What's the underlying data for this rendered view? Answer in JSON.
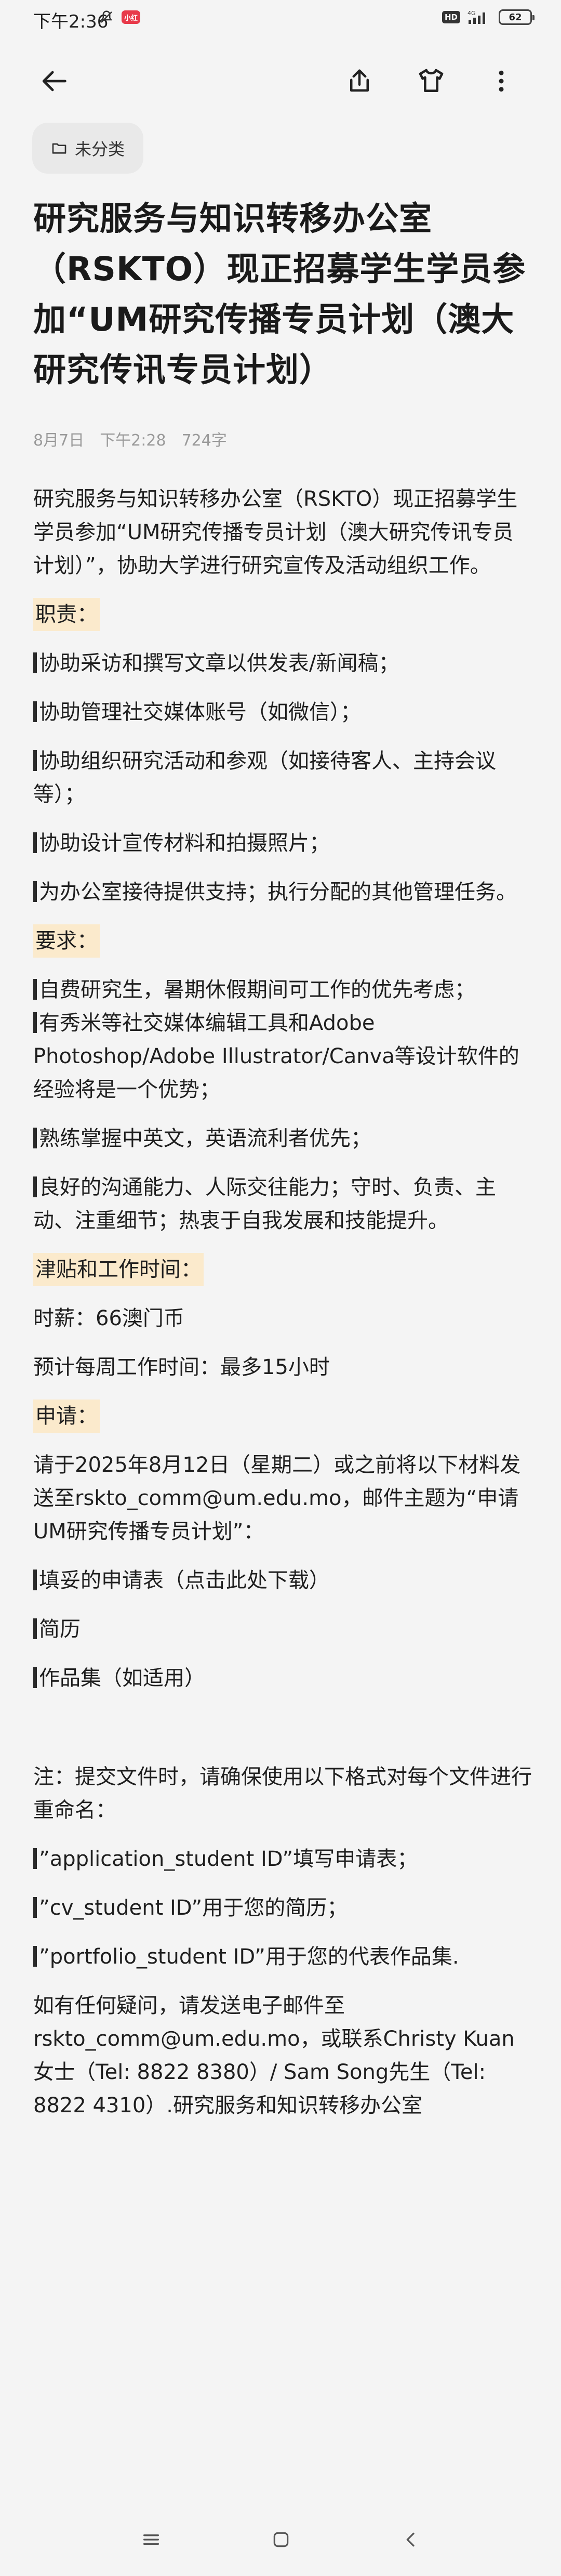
{
  "status_bar": {
    "time": "下午2:36",
    "app_badge": "小红",
    "hd_label": "HD",
    "network_label": "4G",
    "battery": "62"
  },
  "toolbar": {
    "back_icon": "arrow-left-icon",
    "share_icon": "share-icon",
    "shirt_icon": "shirt-icon",
    "more_icon": "more-vertical-icon"
  },
  "category": {
    "icon": "folder-icon",
    "label": "未分类"
  },
  "article": {
    "title": "研究服务与知识转移办公室（RSKTO）现正招募学生学员参加“UM研究传播专员计划（澳大研究传讯专员计划）",
    "meta": {
      "date": "8月7日",
      "time": "下午2:28",
      "word_count": "724字"
    },
    "intro": "研究服务与知识转移办公室（RSKTO）现正招募学生学员参加“UM研究传播专员计划（澳大研究传讯专员计划）”，协助大学进行研究宣传及活动组织工作。",
    "duties_heading": "职责：",
    "duties": [
      "协助采访和撰写文章以供发表/新闻稿；",
      "协助管理社交媒体账号（如微信）；",
      "协助组织研究活动和参观（如接待客人、主持会议等）；",
      "协助设计宣传材料和拍摄照片；",
      "为办公室接待提供支持；执行分配的其他管理任务。"
    ],
    "requirements_heading": "要求：",
    "requirements": [
      "自费研究生，暑期休假期间可工作的优先考虑；",
      "有秀米等社交媒体编辑工具和Adobe Photoshop/Adobe Illustrator/Canva等设计软件的经验将是一个优势；",
      "熟练掌握中英文，英语流利者优先；",
      "良好的沟通能力、人际交往能力；守时、负责、主动、注重细节；热衷于自我发展和技能提升。"
    ],
    "allowance_heading": "津贴和工作时间：",
    "hourly_pay": "时薪：66澳门币",
    "weekly_hours": "预计每周工作时间：最多15小时",
    "apply_heading": "申请：",
    "apply_text": "请于2025年8月12日（星期二）或之前将以下材料发送至rskto_comm@um.edu.mo，邮件主题为“申请UM研究传播专员计划”：",
    "materials": [
      "填妥的申请表（点击此处下载）",
      "简历",
      "作品集（如适用）"
    ],
    "note": "注：提交文件时，请确保使用以下格式对每个文件进行重命名：",
    "naming": [
      "”application_student ID”填写申请表；",
      "”cv_student ID”用于您的简历；",
      "”portfolio_student ID”用于您的代表作品集."
    ],
    "contact": "如有任何疑问，请发送电子邮件至rskto_comm@um.edu.mo，或联系Christy Kuan女士（Tel: 8822 8380）/ Sam Song先生（Tel: 8822 4310）.研究服务和知识转移办公室"
  },
  "bottom_nav": {
    "menu_icon": "menu-icon",
    "home_icon": "home-square-icon",
    "back_icon": "back-triangle-icon"
  }
}
